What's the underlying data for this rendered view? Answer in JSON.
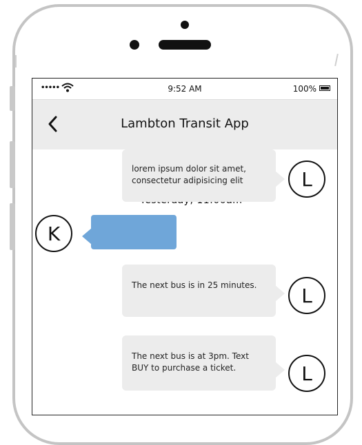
{
  "status_bar": {
    "signal": "•••••",
    "time": "9:52 AM",
    "battery": "100%"
  },
  "nav": {
    "title": "Lambton Transit App",
    "back_icon": "chevron-left-icon"
  },
  "messages": [
    {
      "avatar": "L",
      "text_line1": "lorem ipsum dolor sit amet,",
      "text_line2": "consectetur adipisicing elit"
    },
    {
      "timestamp": "Yesterday, 11:00am"
    },
    {
      "avatar": "K",
      "text": ""
    },
    {
      "avatar": "L",
      "text": "The next bus is in 25 minutes."
    },
    {
      "avatar": "L",
      "text_line1": "The next bus is at 3pm. Text",
      "text_line2": "BUY to purchase a ticket."
    }
  ],
  "colors": {
    "sent_bubble": "#6fa6d9",
    "received_bubble": "#ececec",
    "nav_bar": "#ececec"
  }
}
